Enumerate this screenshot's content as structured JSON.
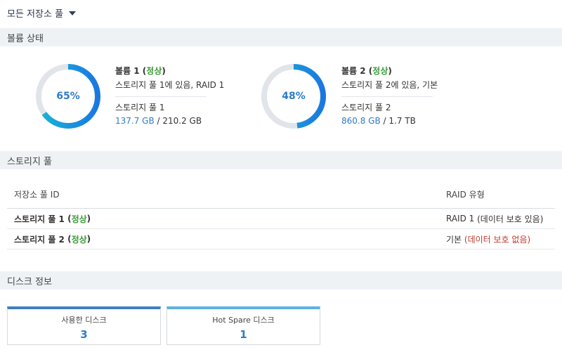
{
  "header": {
    "pool_selector": "모든 저장소 풀"
  },
  "sections": {
    "volume_status": "볼륨 상태",
    "storage_pool": "스토리지 풀",
    "disk_info": "디스크 정보"
  },
  "volumes": [
    {
      "name": "볼륨 1",
      "status": "정상",
      "percent_label": "65%",
      "usage_fraction": 0.65,
      "location": "스토리지 풀 1에 있음, RAID 1",
      "pool": "스토리지 풀 1",
      "used": "137.7 GB",
      "total": "210.2 GB"
    },
    {
      "name": "볼륨 2",
      "status": "정상",
      "percent_label": "48%",
      "usage_fraction": 0.48,
      "location": "스토리지 풀 2에 있음, 기본",
      "pool": "스토리지 풀 2",
      "used": "860.8 GB",
      "total": "1.7 TB"
    }
  ],
  "pool_table": {
    "headers": {
      "id": "저장소 풀 ID",
      "raid": "RAID 유형"
    },
    "rows": [
      {
        "name": "스토리지 풀 1",
        "status": "정상",
        "raid": "RAID 1",
        "protection": "(데이터 보호 있음)"
      },
      {
        "name": "스토리지 풀 2",
        "status": "정상",
        "raid": "기본",
        "protection": "(데이터 보호 없음)"
      }
    ]
  },
  "disk_cards": [
    {
      "label": "사용한 디스크",
      "value": "3"
    },
    {
      "label": "Hot Spare 디스크",
      "value": "1"
    }
  ],
  "colors": {
    "status_ok": "#3a9c39",
    "warning": "#c0392b",
    "accent_blue": "#2f7cc7",
    "donut_track": "#e1e4e8",
    "donut_start": "#17b7d8",
    "donut_end": "#1b77e0",
    "card_border_used": "#3f7fc4",
    "card_border_spare": "#5bb2e3"
  }
}
